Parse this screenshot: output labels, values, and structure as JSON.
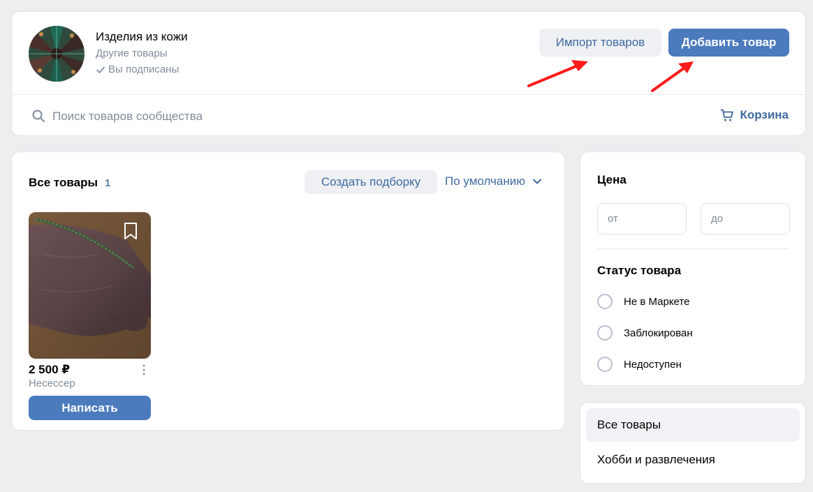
{
  "header": {
    "group_title": "Изделия из кожи",
    "group_subtitle": "Другие товары",
    "subscribed_label": "Вы подписаны",
    "import_button": "Импорт товаров",
    "add_button": "Добавить товар",
    "search_placeholder": "Поиск товаров сообщества",
    "cart_label": "Корзина"
  },
  "main": {
    "section_title": "Все товары",
    "section_count": "1",
    "create_collection_button": "Создать подборку",
    "sort_label": "По умолчанию",
    "products": [
      {
        "price": "2 500 ₽",
        "name": "Несессер",
        "action_label": "Написать"
      }
    ]
  },
  "filters": {
    "price_title": "Цена",
    "price_from_placeholder": "от",
    "price_to_placeholder": "до",
    "status_title": "Статус товара",
    "status_options": [
      "Не в Маркете",
      "Заблокирован",
      "Недоступен"
    ]
  },
  "categories": {
    "items": [
      "Все товары",
      "Хобби и развлечения"
    ],
    "active_index": 0
  },
  "colors": {
    "accent": "#4b7bbd",
    "link": "#3f6aa0",
    "secondary_text": "#818c99",
    "annotation_arrow": "#ff1a1a"
  },
  "icons": [
    "check-icon",
    "search-icon",
    "cart-icon",
    "chevron-down-icon",
    "bookmark-icon",
    "more-vertical-icon"
  ]
}
